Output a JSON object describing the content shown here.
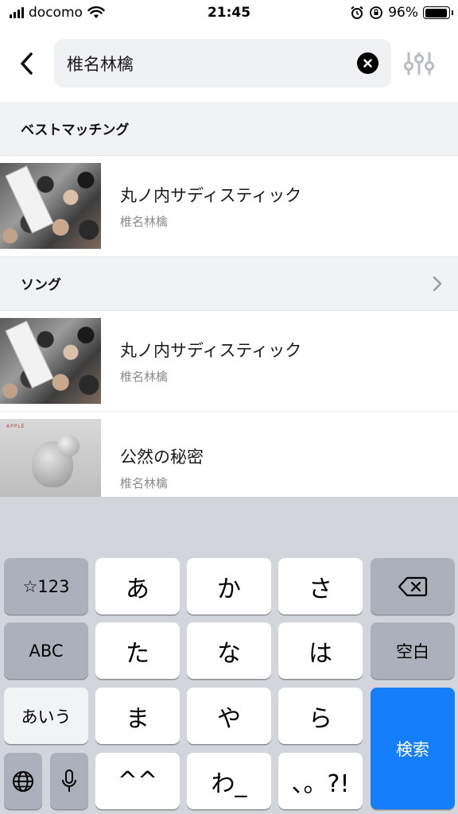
{
  "status_bar": {
    "carrier": "docomo",
    "time": "21:45",
    "battery_percent": "96%",
    "battery_level": 0.96
  },
  "search": {
    "query": "椎名林檎"
  },
  "sections": {
    "best_match": "ベストマッチング",
    "songs": "ソング"
  },
  "best_match_item": {
    "title": "丸ノ内サディスティック",
    "artist": "椎名林檎"
  },
  "songs": [
    {
      "title": "丸ノ内サディスティック",
      "artist": "椎名林檎"
    },
    {
      "title": "公然の秘密",
      "artist": "椎名林檎"
    }
  ],
  "keyboard": {
    "row1": [
      "☆123",
      "あ",
      "か",
      "さ"
    ],
    "row2": [
      "ABC",
      "た",
      "な",
      "は",
      "空白"
    ],
    "row3": [
      "あいう",
      "ま",
      "や",
      "ら"
    ],
    "row4": [
      "^^",
      "わ_",
      "、。?!"
    ],
    "search_key": "検索"
  },
  "colors": {
    "accent_blue": "#147efb",
    "section_bg": "#f1f2f4",
    "keyboard_bg": "#d2d5db"
  },
  "icons": [
    "back-chevron-icon",
    "clear-icon",
    "filter-sliders-icon",
    "chevron-right-icon",
    "delete-icon",
    "globe-icon",
    "microphone-icon",
    "wifi-icon",
    "alarm-icon",
    "rotation-lock-icon",
    "battery-icon"
  ]
}
